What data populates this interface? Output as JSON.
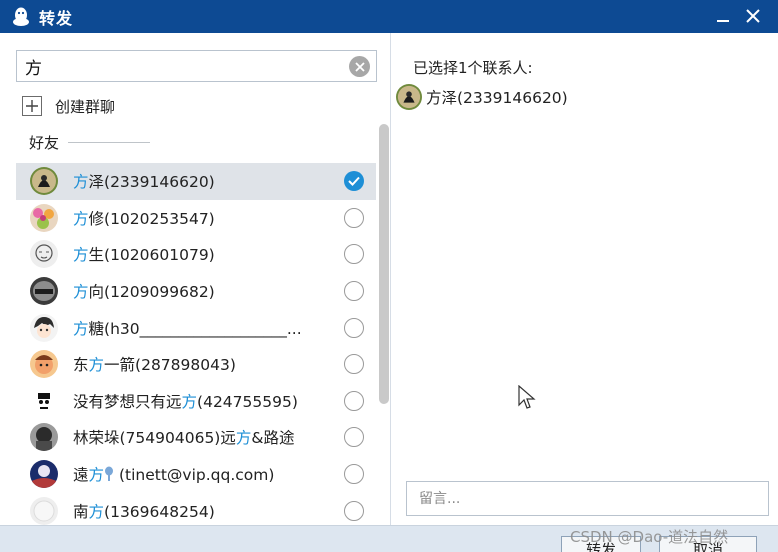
{
  "window": {
    "title": "转发",
    "minimize_label": "_",
    "close_label": "✕"
  },
  "search": {
    "value": "方",
    "placeholder": ""
  },
  "create_group": {
    "label": "创建群聊"
  },
  "section": {
    "title": "好友"
  },
  "contacts": [
    {
      "prefix": "",
      "match": "方",
      "suffix": "泽(2339146620)",
      "selected": true,
      "avatar": "avatar-fangze"
    },
    {
      "prefix": "",
      "match": "方",
      "suffix": "修(1020253547)",
      "selected": false,
      "avatar": "avatar-flowers"
    },
    {
      "prefix": "",
      "match": "方",
      "suffix": "生(1020601079)",
      "selected": false,
      "avatar": "avatar-sketch"
    },
    {
      "prefix": "",
      "match": "方",
      "suffix": "向(1209099682)",
      "selected": false,
      "avatar": "avatar-helmet"
    },
    {
      "prefix": "",
      "match": "方",
      "suffix": "糖(h30___________________...",
      "selected": false,
      "avatar": "avatar-anime"
    },
    {
      "prefix": "东",
      "match": "方",
      "suffix": "一箭(287898043)",
      "selected": false,
      "avatar": "avatar-cartoon"
    },
    {
      "prefix": "没有梦想只有远",
      "match": "方",
      "suffix": "(424755595)",
      "selected": false,
      "avatar": "avatar-bw-face"
    },
    {
      "prefix": "林荣垛(754904065)远",
      "match": "方",
      "suffix": "&路途",
      "selected": false,
      "avatar": "avatar-dark"
    },
    {
      "prefix": "遠",
      "match": "方",
      "suffix": " (tinett@vip.qq.com)",
      "selected": false,
      "avatar": "avatar-night",
      "has_badge": true
    },
    {
      "prefix": "南",
      "match": "方",
      "suffix": "(1369648254)",
      "selected": false,
      "avatar": "avatar-white"
    }
  ],
  "right": {
    "selected_count_label": "已选择1个联系人:",
    "selected_contact": "方泽(2339146620)",
    "message_placeholder": "留言..."
  },
  "buttons": {
    "forward": "转发",
    "cancel": "取消"
  },
  "watermark": "CSDN @Dao-道法自然",
  "colors": {
    "titlebar": "#0d4a93",
    "highlight": "#1e8fd6",
    "selected_row": "#dfe3e8"
  }
}
